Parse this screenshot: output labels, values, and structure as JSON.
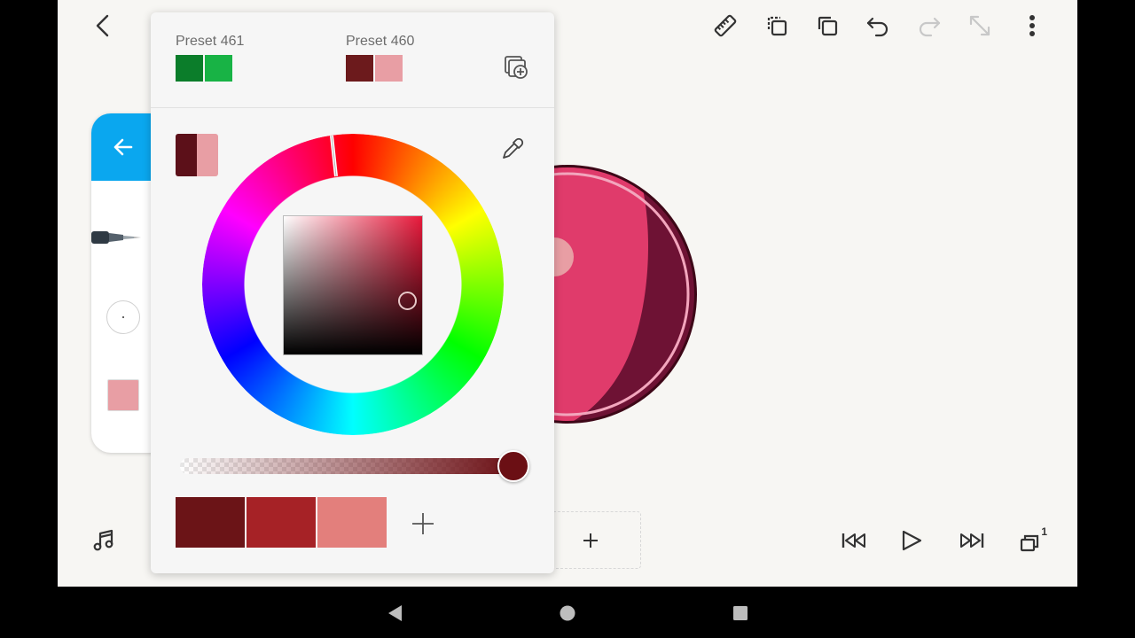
{
  "presets": [
    {
      "label": "Preset 461",
      "colors": [
        "#0b7d2a",
        "#18b345"
      ]
    },
    {
      "label": "Preset 460",
      "colors": [
        "#6c1a1c",
        "#e89ea4"
      ]
    }
  ],
  "picker": {
    "current_colors": [
      "#5c1019",
      "#e89ea4"
    ],
    "opacity_color": "#6b0f14",
    "recent_colors": [
      "#6b1417",
      "#a62226",
      "#e37f7c"
    ]
  },
  "tool_panel": {
    "brush_color": "#e89ea4"
  },
  "accent_color": "#0aa7ef",
  "icons": {
    "top": [
      "back-icon",
      "ruler-icon",
      "copy-icon",
      "duplicate-icon",
      "undo-icon",
      "redo-icon",
      "expand-icon",
      "more-icon"
    ],
    "bottom": [
      "music-icon",
      "add-frame-icon",
      "skip-back-icon",
      "play-icon",
      "skip-forward-icon",
      "layers-icon"
    ],
    "layers_badge": "1"
  }
}
